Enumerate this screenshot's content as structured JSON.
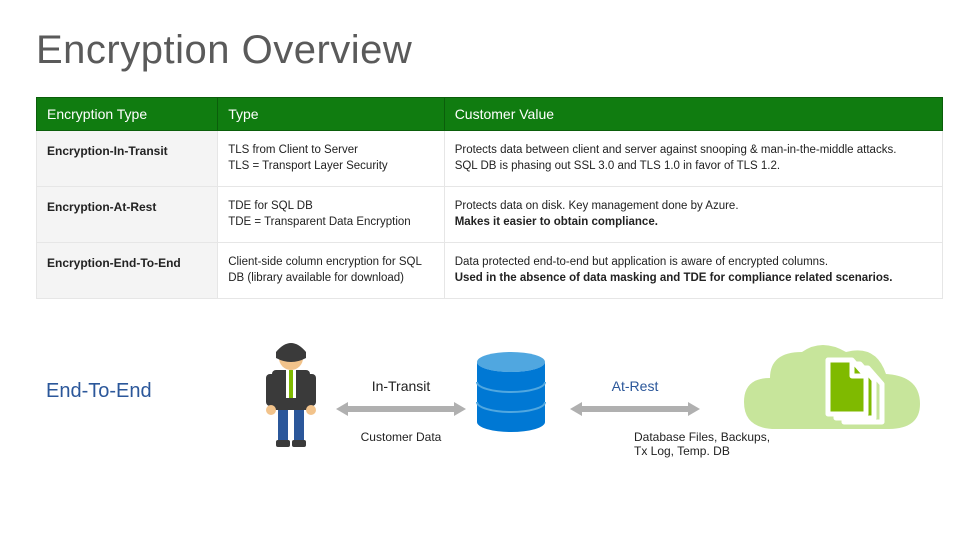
{
  "title": "Encryption Overview",
  "headers": {
    "h1": "Encryption Type",
    "h2": "Type",
    "h3": "Customer Value"
  },
  "rows": [
    {
      "label": "Encryption-In-Transit",
      "type_l1": "TLS from Client to Server",
      "type_l2": "TLS = Transport Layer Security",
      "val_l1": "Protects data between client and server against snooping & man-in-the-middle attacks.",
      "val_l2": "SQL DB is phasing out SSL 3.0 and TLS 1.0 in favor of TLS 1.2."
    },
    {
      "label": "Encryption-At-Rest",
      "type_l1": "TDE for SQL DB",
      "type_l2": "TDE = Transparent Data Encryption",
      "val_l1": "Protects data on disk. Key management done by Azure.",
      "val_l2_bold": "Makes it easier to obtain compliance."
    },
    {
      "label": "Encryption-End-To-End",
      "type_l1": "Client-side column encryption for SQL DB (library available for download)",
      "val_l1": "Data protected end-to-end but application is aware of encrypted columns.",
      "val_l2_bold": "Used in the absence of data masking and TDE for compliance related scenarios."
    }
  ],
  "diagram": {
    "end_to_end": "End-To-End",
    "in_transit": "In-Transit",
    "customer_data": "Customer Data",
    "at_rest": "At-Rest",
    "db_files": "Database Files, Backups, Tx Log, Temp. DB"
  },
  "colors": {
    "header_green": "#107c10",
    "accent_blue": "#2b579a",
    "db_blue": "#0078d4",
    "cloud_green": "#7fba00"
  }
}
